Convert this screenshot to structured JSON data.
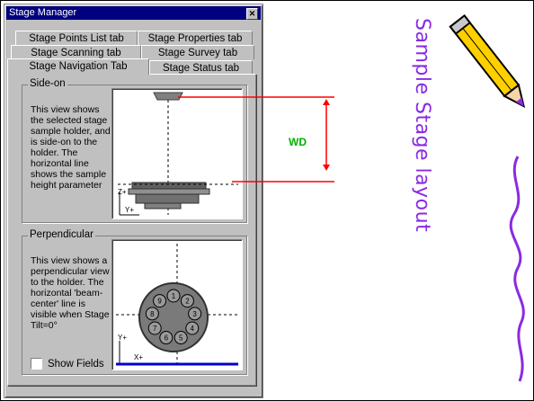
{
  "window": {
    "title": "Stage Manager",
    "close_glyph": "✕",
    "tabs": [
      {
        "label": "Stage Points List tab"
      },
      {
        "label": "Stage Properties tab"
      },
      {
        "label": "Stage Scanning tab"
      },
      {
        "label": "Stage Survey tab"
      },
      {
        "label": "Stage Navigation Tab"
      },
      {
        "label": "Stage Status tab"
      }
    ],
    "active_tab": "Stage Navigation Tab",
    "side_on": {
      "legend": "Side-on",
      "description": "This view shows the selected stage sample holder, and is side-on to the holder. The horizontal line shows the sample height parameter",
      "axis_z": "Z+",
      "axis_y": "Y+"
    },
    "perpendicular": {
      "legend": "Perpendicular",
      "description": "This view shows a perpendicular view to the holder. The horizontal 'beam-center' line is visible when Stage Tilt=0°",
      "axis_y": "Y+",
      "axis_x": "X+",
      "holder_positions": [
        "1",
        "2",
        "3",
        "4",
        "5",
        "6",
        "7",
        "8",
        "9"
      ],
      "show_fields_label": "Show Fields",
      "show_fields_checked": false
    }
  },
  "annotation": {
    "wd_label": "WD",
    "wd_color": "#00b000",
    "line_color": "#ff0000"
  },
  "slide": {
    "title": "Sample Stage layout",
    "title_color": "#8a2be2",
    "decoration": "pencil-icon"
  }
}
